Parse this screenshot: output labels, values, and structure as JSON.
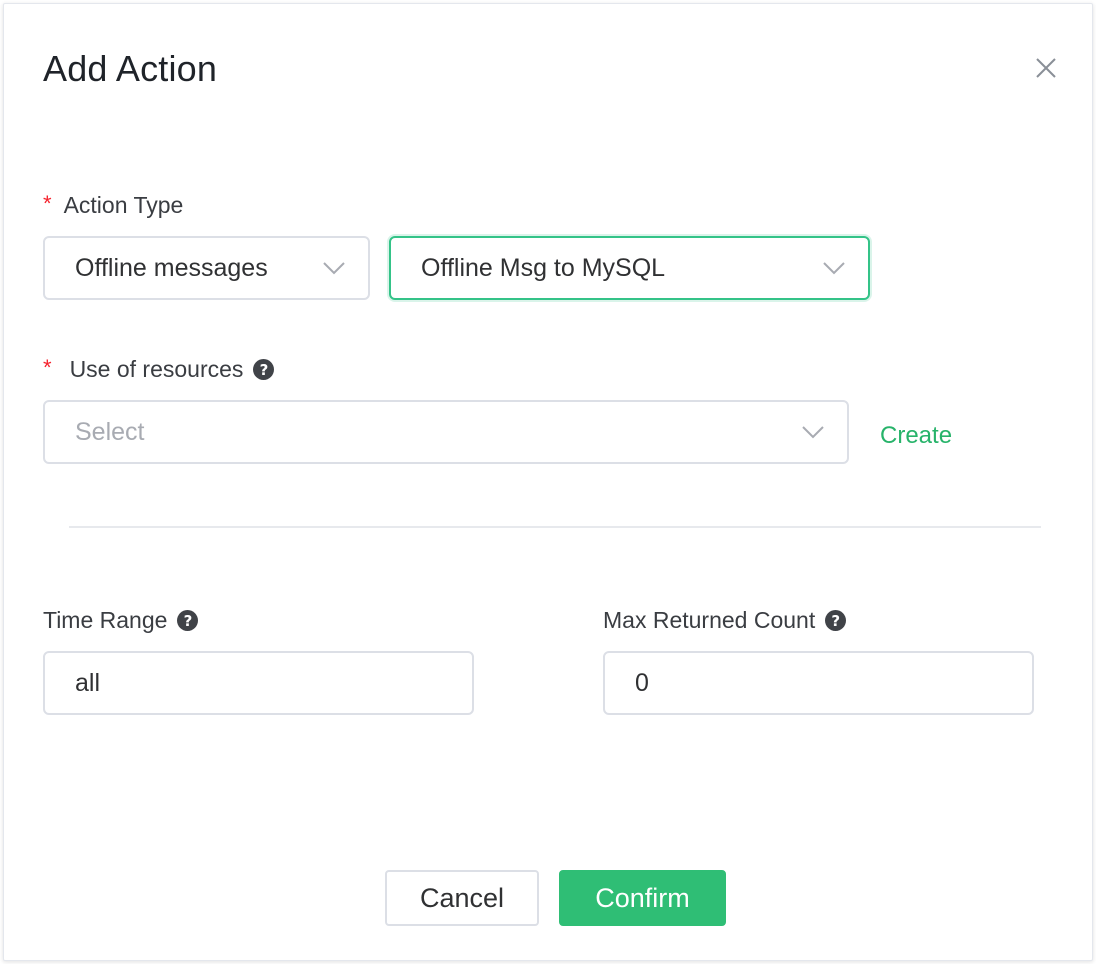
{
  "dialog": {
    "title": "Add Action",
    "close_icon": "close-icon"
  },
  "action_type": {
    "label": "Action Type",
    "required_mark": "*",
    "category_value": "Offline messages",
    "type_value": "Offline Msg to MySQL",
    "chevron_icon": "chevron-down-icon"
  },
  "resources": {
    "label": "Use of resources",
    "required_mark": "*",
    "help_icon": "question-circle-icon",
    "help_glyph": "?",
    "placeholder": "Select",
    "create_link": "Create"
  },
  "time_range": {
    "label": "Time Range",
    "help_glyph": "?",
    "value": "all"
  },
  "max_count": {
    "label": "Max Returned Count",
    "help_glyph": "?",
    "value": "0"
  },
  "footer": {
    "cancel_label": "Cancel",
    "confirm_label": "Confirm"
  },
  "colors": {
    "accent": "#2fbe75",
    "link": "#27b36a",
    "required": "#f5222d",
    "focus_border": "#34c388"
  }
}
